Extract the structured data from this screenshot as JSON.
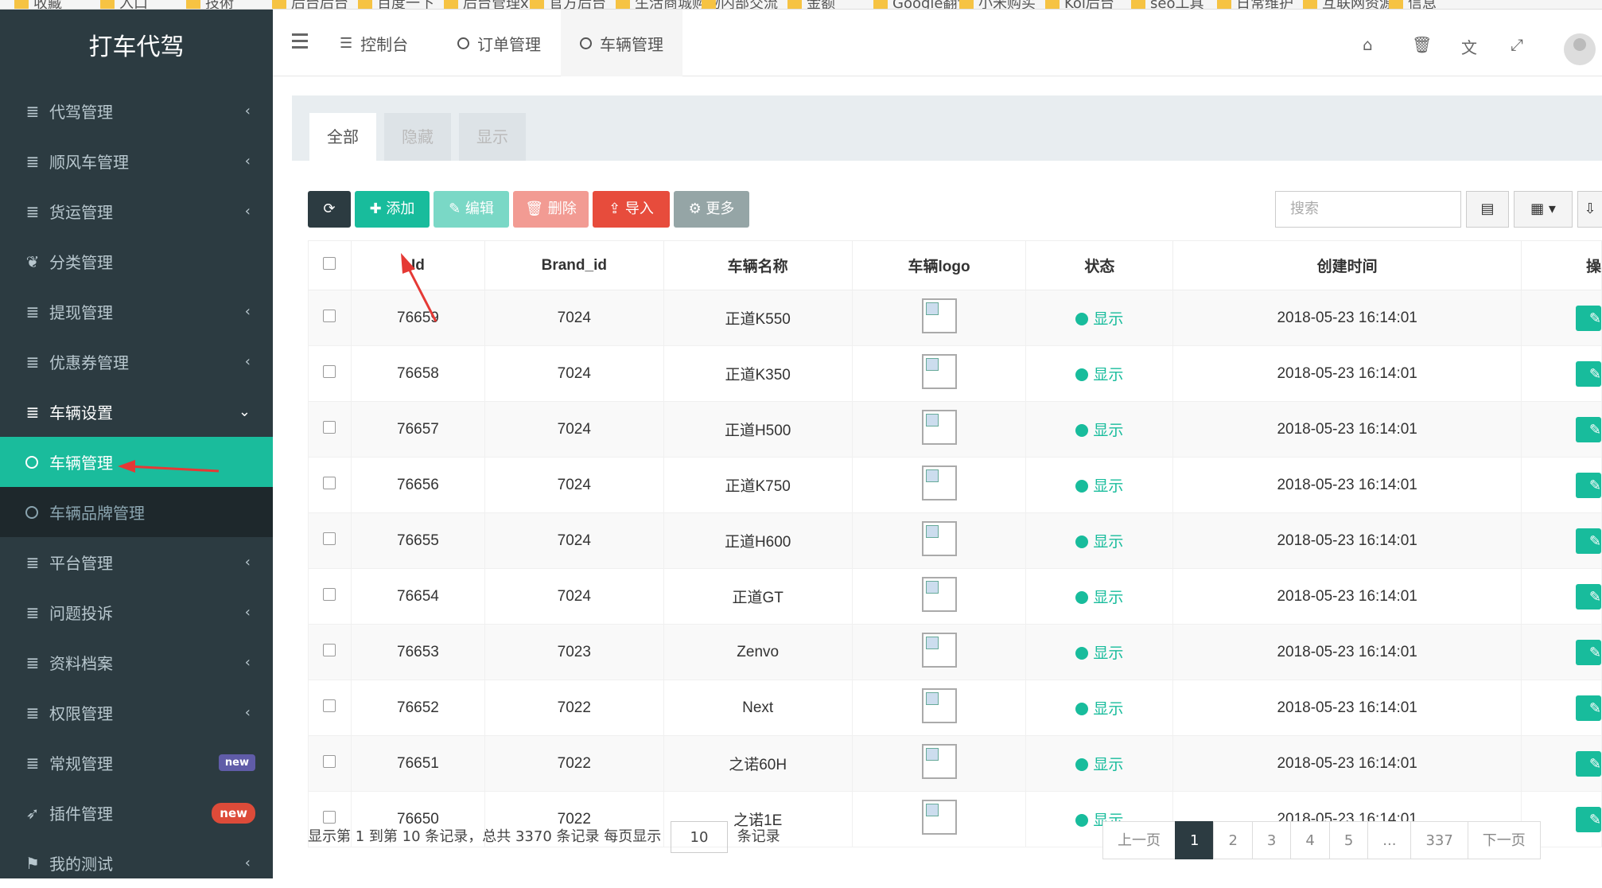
{
  "bookmarks": [
    "收藏",
    "入口",
    "技術",
    "后台后台",
    "百度一下",
    "后台管理xh",
    "官方后台",
    "生活商城购物",
    "内部交流",
    "金额",
    "Google翻译",
    "小米购买",
    "Kol后台",
    "seo工具",
    "日常维护",
    "互联网资源",
    "信息"
  ],
  "sidebar": {
    "brand": "打车代驾",
    "items": [
      {
        "label": "代驾管理",
        "icon": "≣",
        "arrow": "‹"
      },
      {
        "label": "顺风车管理",
        "icon": "≣",
        "arrow": "‹"
      },
      {
        "label": "货运管理",
        "icon": "≣",
        "arrow": "‹"
      },
      {
        "label": "分类管理",
        "icon": "❦",
        "arrow": ""
      },
      {
        "label": "提现管理",
        "icon": "≣",
        "arrow": "‹"
      },
      {
        "label": "优惠券管理",
        "icon": "≣",
        "arrow": "‹"
      },
      {
        "label": "车辆设置",
        "icon": "≣",
        "arrow": "⌄"
      }
    ],
    "sub_items": [
      {
        "label": "车辆管理"
      },
      {
        "label": "车辆品牌管理"
      }
    ],
    "items2": [
      {
        "label": "平台管理",
        "icon": "≣",
        "arrow": "‹"
      },
      {
        "label": "问题投诉",
        "icon": "≣",
        "arrow": "‹"
      },
      {
        "label": "资料档案",
        "icon": "≣",
        "arrow": "‹"
      },
      {
        "label": "权限管理",
        "icon": "≣",
        "arrow": "‹"
      },
      {
        "label": "常规管理",
        "icon": "≣",
        "badge": "new"
      },
      {
        "label": "插件管理",
        "icon": "➶",
        "badge": "new"
      },
      {
        "label": "我的测试",
        "icon": "⚑",
        "arrow": "‹"
      }
    ]
  },
  "header": {
    "tabs": [
      "控制台",
      "订单管理",
      "车辆管理"
    ],
    "icons": [
      "home-icon",
      "trash-icon",
      "translate-icon",
      "fullscreen-icon"
    ]
  },
  "panel": {
    "tabs": [
      "全部",
      "隐藏",
      "显示"
    ]
  },
  "toolbar": {
    "refresh": "⟳",
    "add": "✚ 添加",
    "edit": "✎ 编辑",
    "delete": "🗑 删除",
    "import": "⇪ 导入",
    "more": "⚙ 更多",
    "search_placeholder": "搜索"
  },
  "table": {
    "columns": [
      "Id",
      "Brand_id",
      "车辆名称",
      "车辆logo",
      "状态",
      "创建时间",
      "操"
    ],
    "rows": [
      {
        "id": "76659",
        "brand_id": "7024",
        "name": "正道K550",
        "status": "显示",
        "created": "2018-05-23 16:14:01"
      },
      {
        "id": "76658",
        "brand_id": "7024",
        "name": "正道K350",
        "status": "显示",
        "created": "2018-05-23 16:14:01"
      },
      {
        "id": "76657",
        "brand_id": "7024",
        "name": "正道H500",
        "status": "显示",
        "created": "2018-05-23 16:14:01"
      },
      {
        "id": "76656",
        "brand_id": "7024",
        "name": "正道K750",
        "status": "显示",
        "created": "2018-05-23 16:14:01"
      },
      {
        "id": "76655",
        "brand_id": "7024",
        "name": "正道H600",
        "status": "显示",
        "created": "2018-05-23 16:14:01"
      },
      {
        "id": "76654",
        "brand_id": "7024",
        "name": "正道GT",
        "status": "显示",
        "created": "2018-05-23 16:14:01"
      },
      {
        "id": "76653",
        "brand_id": "7023",
        "name": "Zenvo",
        "status": "显示",
        "created": "2018-05-23 16:14:01"
      },
      {
        "id": "76652",
        "brand_id": "7022",
        "name": "Next",
        "status": "显示",
        "created": "2018-05-23 16:14:01"
      },
      {
        "id": "76651",
        "brand_id": "7022",
        "name": "之诺60H",
        "status": "显示",
        "created": "2018-05-23 16:14:01"
      },
      {
        "id": "76650",
        "brand_id": "7022",
        "name": "之诺1E",
        "status": "显示",
        "created": "2018-05-23 16:14:01"
      }
    ]
  },
  "footer": {
    "info_pre": "显示第 1 到第 10 条记录，总共 3370 条记录 每页显示",
    "page_size": "10",
    "info_post": "条记录",
    "pager": [
      "上一页",
      "1",
      "2",
      "3",
      "4",
      "5",
      "...",
      "337",
      "下一页"
    ]
  },
  "colors": {
    "accent": "#18bc9c",
    "sidebar": "#2c3b41",
    "danger": "#e74c3c"
  }
}
